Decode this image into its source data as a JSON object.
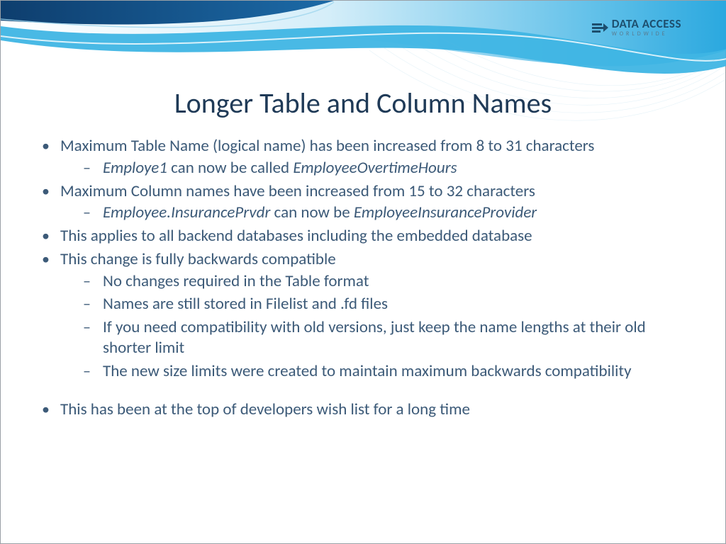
{
  "logo": {
    "line1": "DATA ACCESS",
    "line2": "WORLDWIDE"
  },
  "title": "Longer Table and Column Names",
  "bullets": {
    "b1": "Maximum Table Name (logical name) has been increased from 8 to 31 characters",
    "b1s1_a": "Employe1",
    "b1s1_mid": " can now be called ",
    "b1s1_b": "EmployeeOvertimeHours",
    "b2": "Maximum Column names have been increased from 15 to 32 characters",
    "b2s1_a": "Employee.InsurancePrvdr",
    "b2s1_mid": " can now be ",
    "b2s1_b": "EmployeeInsuranceProvider",
    "b3": "This applies to all backend databases including the embedded database",
    "b4": "This change is fully backwards compatible",
    "b4s1": "No changes required in the Table format",
    "b4s2": "Names are still stored in Filelist and .fd files",
    "b4s3": "If you need compatibility with old versions, just keep the name lengths at their old shorter limit",
    "b4s4": "The new size limits were created to maintain maximum backwards compatibility",
    "b5": "This has been at the top of developers wish list for a long time"
  }
}
